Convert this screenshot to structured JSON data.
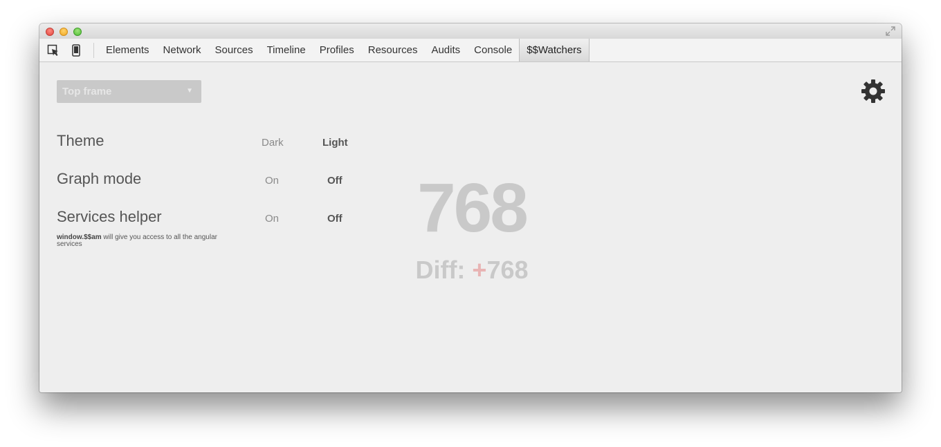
{
  "toolbar": {
    "tabs": [
      {
        "label": "Elements"
      },
      {
        "label": "Network"
      },
      {
        "label": "Sources"
      },
      {
        "label": "Timeline"
      },
      {
        "label": "Profiles"
      },
      {
        "label": "Resources"
      },
      {
        "label": "Audits"
      },
      {
        "label": "Console"
      },
      {
        "label": "$$Watchers",
        "active": true
      }
    ],
    "icons": [
      "inspect-element-icon",
      "device-mode-icon"
    ]
  },
  "panel": {
    "frame_select": {
      "value": "Top frame"
    },
    "settings": {
      "theme": {
        "label": "Theme",
        "options": [
          "Dark",
          "Light"
        ],
        "selected": "Light"
      },
      "graph_mode": {
        "label": "Graph mode",
        "options": [
          "On",
          "Off"
        ],
        "selected": "Off"
      },
      "services_helper": {
        "label": "Services helper",
        "options": [
          "On",
          "Off"
        ],
        "selected": "Off",
        "note_code": "window.$$am",
        "note_text": " will give you access to all the angular services"
      }
    },
    "watchers": {
      "count": "768",
      "diff_label": "Diff: ",
      "diff_sign": "+",
      "diff_value": "768"
    }
  },
  "colors": {
    "background": "#eeeeee",
    "counter": "#c9c9c9",
    "diff_sign": "#e8b4b4"
  }
}
